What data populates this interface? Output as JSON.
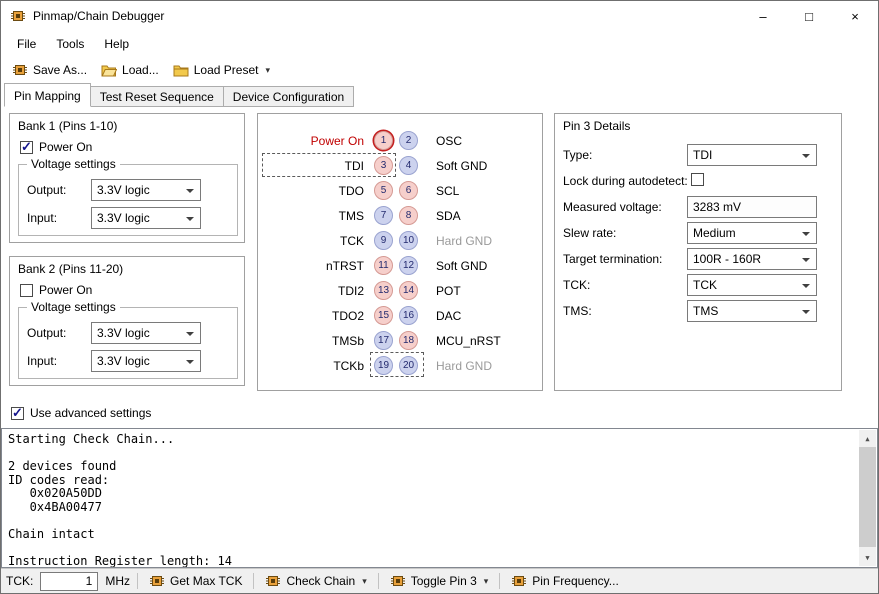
{
  "window": {
    "title": "Pinmap/Chain Debugger",
    "minimize": "–",
    "maximize": "□",
    "close": "×"
  },
  "menu": {
    "file": "File",
    "tools": "Tools",
    "help": "Help"
  },
  "toolbar": {
    "save_as": "Save As...",
    "load": "Load...",
    "load_preset": "Load Preset",
    "dropdown_glyph": "▾"
  },
  "tabs": {
    "pin_mapping": "Pin Mapping",
    "test_reset": "Test Reset Sequence",
    "device_config": "Device Configuration"
  },
  "bank1": {
    "title": "Bank 1 (Pins 1-10)",
    "power_on_label": "Power On",
    "power_on_checked": true,
    "voltage_title": "Voltage settings",
    "output_label": "Output:",
    "output_value": "3.3V logic",
    "input_label": "Input:",
    "input_value": "3.3V logic"
  },
  "bank2": {
    "title": "Bank 2 (Pins 11-20)",
    "power_on_label": "Power On",
    "power_on_checked": false,
    "voltage_title": "Voltage settings",
    "output_label": "Output:",
    "output_value": "3.3V logic",
    "input_label": "Input:",
    "input_value": "3.3V logic"
  },
  "pin_diagram": {
    "rows": [
      {
        "left": "Power On",
        "pins": [
          {
            "n": 1,
            "c": "pink",
            "ring": true
          },
          {
            "n": 2,
            "c": "blue"
          }
        ],
        "right": "OSC"
      },
      {
        "left": "TDI",
        "pins": [
          {
            "n": 3,
            "c": "pink"
          },
          {
            "n": 4,
            "c": "blue"
          }
        ],
        "right": "Soft GND"
      },
      {
        "left": "TDO",
        "pins": [
          {
            "n": 5,
            "c": "pink"
          },
          {
            "n": 6,
            "c": "pink"
          }
        ],
        "right": "SCL"
      },
      {
        "left": "TMS",
        "pins": [
          {
            "n": 7,
            "c": "blue"
          },
          {
            "n": 8,
            "c": "pink"
          }
        ],
        "right": "SDA"
      },
      {
        "left": "TCK",
        "pins": [
          {
            "n": 9,
            "c": "blue"
          },
          {
            "n": 10,
            "c": "blue"
          }
        ],
        "right": "Hard GND"
      },
      {
        "left": "nTRST",
        "pins": [
          {
            "n": 11,
            "c": "pink"
          },
          {
            "n": 12,
            "c": "blue"
          }
        ],
        "right": "Soft GND"
      },
      {
        "left": "TDI2",
        "pins": [
          {
            "n": 13,
            "c": "pink"
          },
          {
            "n": 14,
            "c": "pink"
          }
        ],
        "right": "POT"
      },
      {
        "left": "TDO2",
        "pins": [
          {
            "n": 15,
            "c": "pink"
          },
          {
            "n": 16,
            "c": "blue"
          }
        ],
        "right": "DAC"
      },
      {
        "left": "TMSb",
        "pins": [
          {
            "n": 17,
            "c": "blue"
          },
          {
            "n": 18,
            "c": "pink"
          }
        ],
        "right": "MCU_nRST"
      },
      {
        "left": "TCKb",
        "pins": [
          {
            "n": 19,
            "c": "blue"
          },
          {
            "n": 20,
            "c": "blue"
          }
        ],
        "right": "Hard GND"
      }
    ]
  },
  "details": {
    "title": "Pin 3 Details",
    "type_label": "Type:",
    "type_value": "TDI",
    "lock_label": "Lock during autodetect:",
    "lock_checked": false,
    "measured_label": "Measured voltage:",
    "measured_value": "3283 mV",
    "slew_label": "Slew rate:",
    "slew_value": "Medium",
    "termination_label": "Target termination:",
    "termination_value": "100R - 160R",
    "tck_label": "TCK:",
    "tck_value": "TCK",
    "tms_label": "TMS:",
    "tms_value": "TMS"
  },
  "advanced": {
    "label": "Use advanced settings",
    "checked": true
  },
  "console": {
    "lines": [
      "Starting Check Chain...",
      "",
      "2 devices found",
      "ID codes read:",
      "   0x020A50DD",
      "   0x4BA00477",
      "",
      "Chain intact",
      "",
      "Instruction Register length: 14"
    ],
    "scroll_up_glyph": "▲",
    "scroll_down_glyph": "▼"
  },
  "statusbar": {
    "tck_label": "TCK:",
    "tck_value": "1",
    "unit": "MHz",
    "get_max_tck": "Get Max TCK",
    "check_chain": "Check Chain",
    "toggle_pin": "Toggle Pin 3",
    "pin_frequency": "Pin Frequency...",
    "dropdown_glyph": "▾"
  },
  "colors": {
    "pin_pink": "#f6cfcb",
    "pin_pink_border": "#d59a94",
    "pin_blue": "#ccd2ee",
    "pin_blue_border": "#9aa3d0",
    "pin_number_text": "#232a6e",
    "selected_pin_ring": "#c41e1e",
    "power_on_label": "#c00000",
    "muted_label": "#9a9a9a"
  }
}
